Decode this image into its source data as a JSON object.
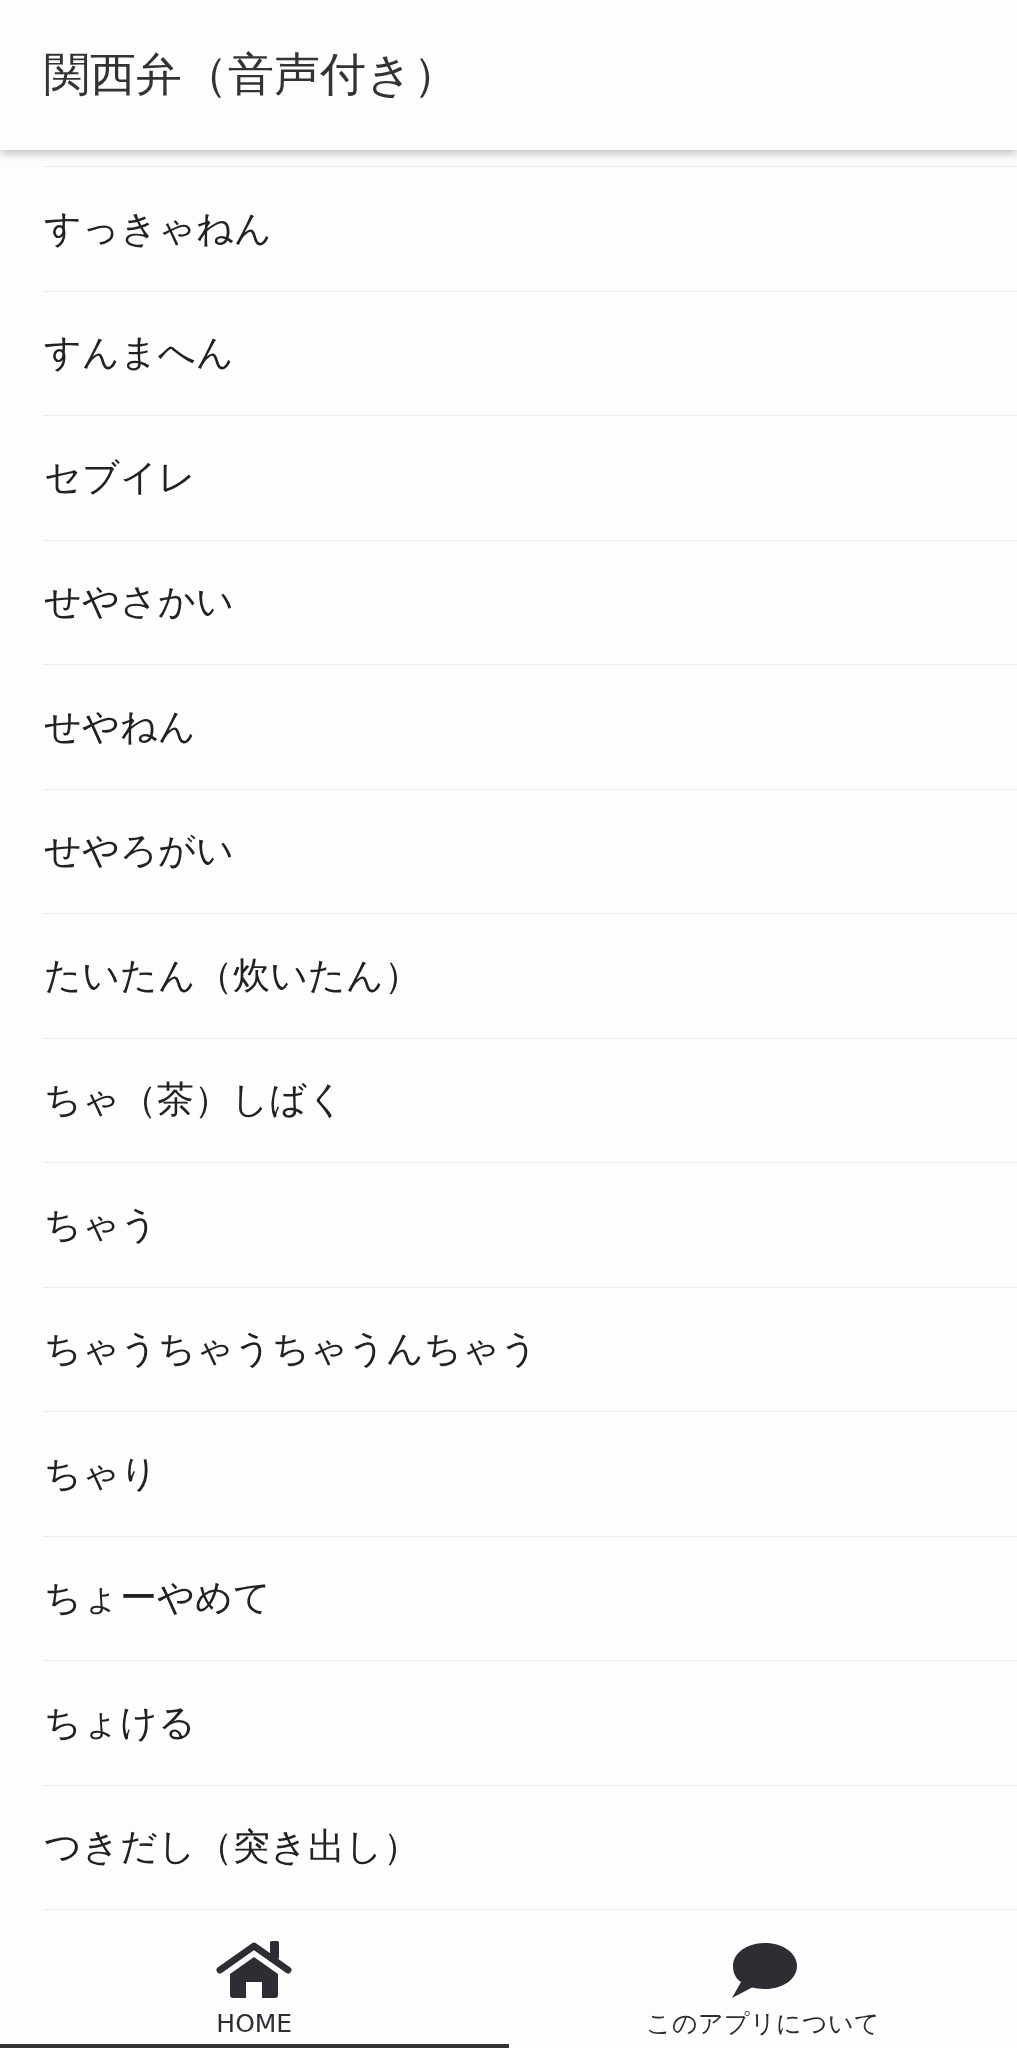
{
  "header": {
    "title": "関西弁（音声付き）"
  },
  "list": {
    "items": [
      "すっきゃねん",
      "すんまへん",
      "セブイレ",
      "せやさかい",
      "せやねん",
      "せやろがい",
      "たいたん（炊いたん）",
      "ちゃ（茶）しばく",
      "ちゃう",
      "ちゃうちゃうちゃうんちゃう",
      "ちゃり",
      "ちょーやめて",
      "ちょける",
      "つきだし（突き出し）"
    ]
  },
  "tab_bar": {
    "tabs": [
      {
        "kind": "home",
        "label": "HOME",
        "selected": true
      },
      {
        "kind": "about",
        "label": "このアプリについて",
        "selected": false
      }
    ]
  }
}
